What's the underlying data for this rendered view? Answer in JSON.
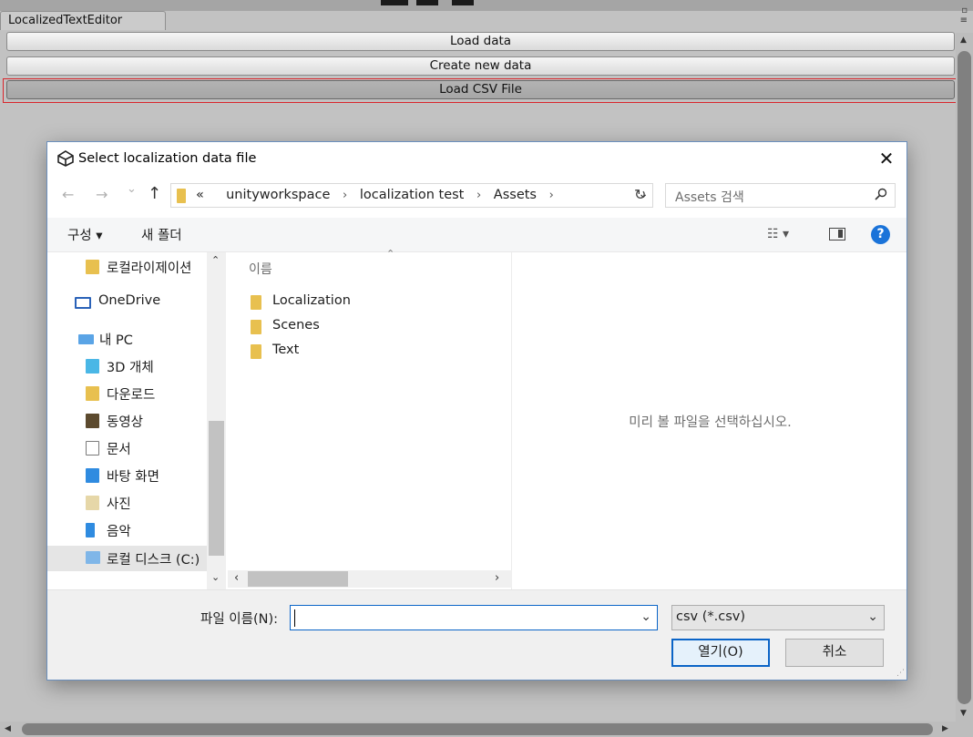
{
  "unity": {
    "tab_title": "LocalizedTextEditor",
    "buttons": {
      "load_data": "Load data",
      "create_new_data": "Create new data",
      "load_csv_file": "Load CSV File"
    }
  },
  "dialog": {
    "title": "Select localization data file",
    "close_glyph": "✕",
    "nav": {
      "back_glyph": "←",
      "forward_glyph": "→",
      "recent_glyph": "⌄",
      "up_glyph": "↑",
      "breadcrumb_prefix": "«",
      "breadcrumbs": [
        "unityworkspace",
        "localization test",
        "Assets"
      ],
      "crumb_sep": "›",
      "dropdown_glyph": "⌄",
      "refresh_glyph": "↻",
      "search_placeholder": "Assets 검색",
      "search_glyph": "⚲"
    },
    "commands": {
      "organize": "구성 ▾",
      "new_folder": "새 폴더",
      "view_glyph": "☷ ▾",
      "help_glyph": "?"
    },
    "tree": {
      "items": [
        {
          "label": "로컬라이제이션",
          "icon": "folder-icon"
        },
        {
          "label": "OneDrive",
          "icon": "onedrive-icon"
        },
        {
          "label": "내 PC",
          "icon": "pc-icon"
        },
        {
          "label": "3D 개체",
          "icon": "3d-objects-icon"
        },
        {
          "label": "다운로드",
          "icon": "download-icon"
        },
        {
          "label": "동영상",
          "icon": "video-icon"
        },
        {
          "label": "문서",
          "icon": "document-icon"
        },
        {
          "label": "바탕 화면",
          "icon": "desktop-icon"
        },
        {
          "label": "사진",
          "icon": "pictures-icon"
        },
        {
          "label": "음악",
          "icon": "music-icon"
        },
        {
          "label": "로컬 디스크 (C:)",
          "icon": "disk-icon"
        }
      ],
      "scroll_up_glyph": "⌃",
      "scroll_down_glyph": "⌄"
    },
    "files": {
      "column_name": "이름",
      "sort_glyph": "⌃",
      "items": [
        "Localization",
        "Scenes",
        "Text"
      ],
      "scroll_left_glyph": "‹",
      "scroll_right_glyph": "›"
    },
    "preview": {
      "message": "미리 볼 파일을 선택하십시오."
    },
    "bottom": {
      "filename_label": "파일 이름(N):",
      "filename_value": "",
      "file_type": "csv (*.csv)",
      "open_button": "열기(O)",
      "cancel_button": "취소",
      "dropdown_glyph": "⌄"
    }
  },
  "colors": {
    "folder": "#e8c04f",
    "accent": "#0a64c7",
    "focus_ring": "#d9262c"
  }
}
